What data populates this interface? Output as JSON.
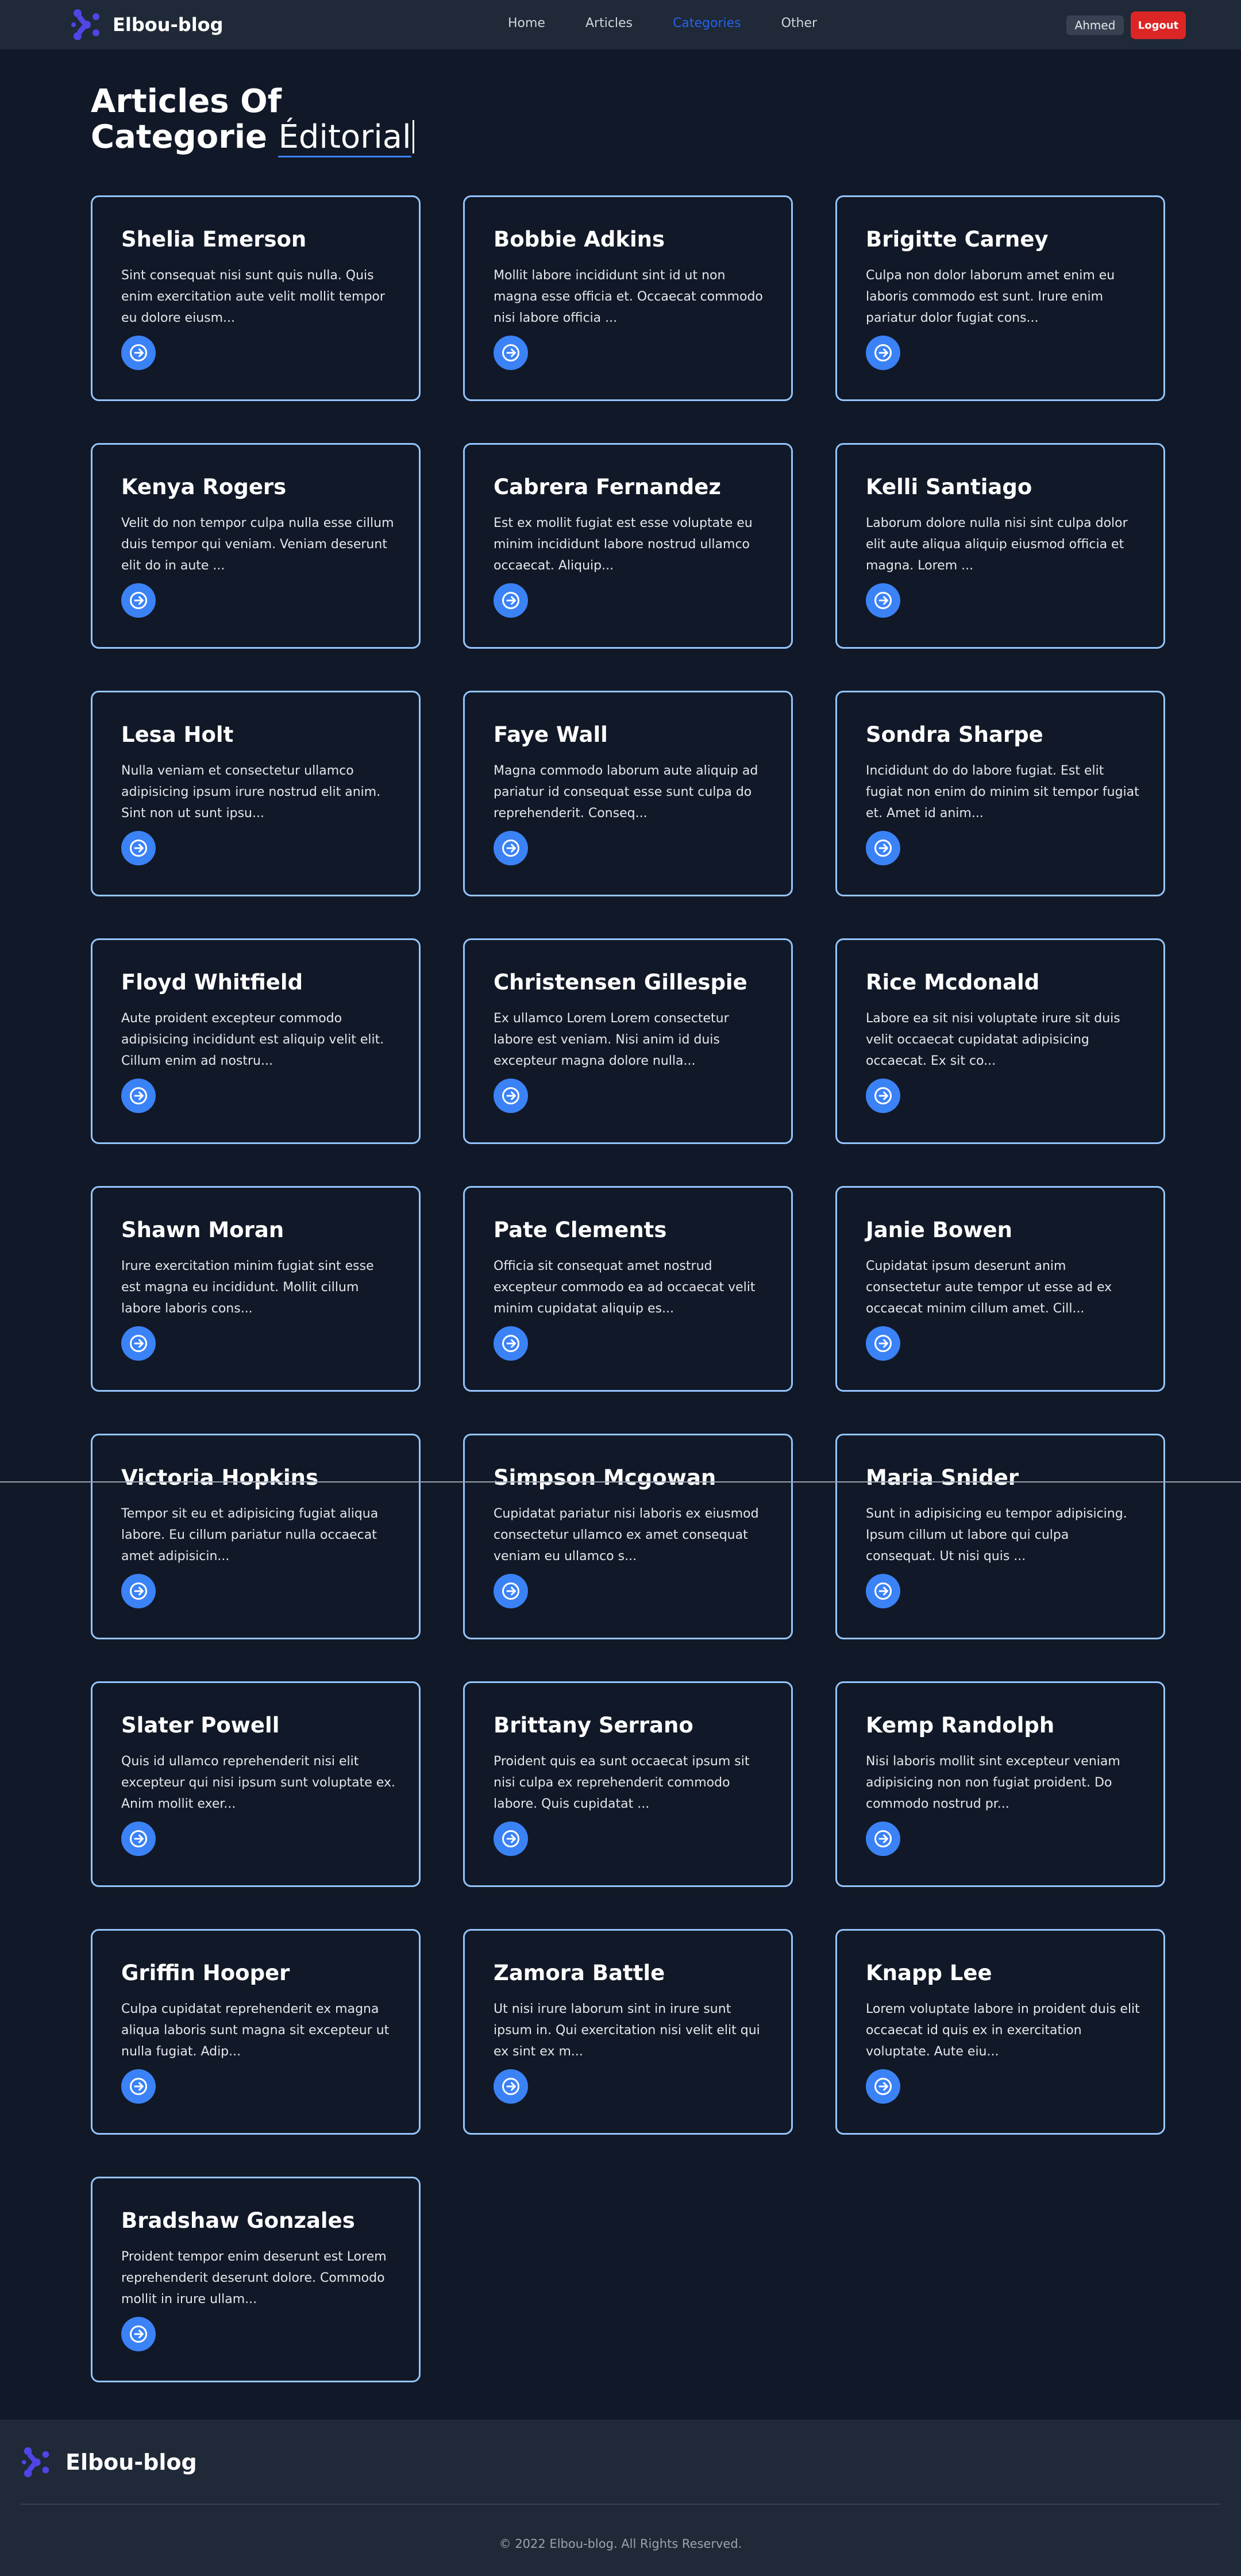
{
  "nav": {
    "brand": "Elbou-blog",
    "links": [
      {
        "label": "Home"
      },
      {
        "label": "Articles"
      },
      {
        "label": "Categories"
      },
      {
        "label": "Other"
      }
    ],
    "user": "Ahmed",
    "logout": "Logout"
  },
  "page": {
    "title_line1": "Articles Of",
    "title_line2_prefix": "Categorie ",
    "title_category": "Éditorial"
  },
  "articles": [
    {
      "name": "Shelia Emerson",
      "excerpt": "Sint consequat nisi sunt quis nulla. Quis enim exercitation aute velit mollit tempor eu dolore eiusm..."
    },
    {
      "name": "Bobbie Adkins",
      "excerpt": "Mollit labore incididunt sint id ut non magna esse officia et. Occaecat commodo nisi labore officia ..."
    },
    {
      "name": "Brigitte Carney",
      "excerpt": "Culpa non dolor laborum amet enim eu laboris commodo est sunt. Irure enim pariatur dolor fugiat cons..."
    },
    {
      "name": "Kenya Rogers",
      "excerpt": "Velit do non tempor culpa nulla esse cillum duis tempor qui veniam. Veniam deserunt elit do in aute ..."
    },
    {
      "name": "Cabrera Fernandez",
      "excerpt": "Est ex mollit fugiat est esse voluptate eu minim incididunt labore nostrud ullamco occaecat. Aliquip..."
    },
    {
      "name": "Kelli Santiago",
      "excerpt": "Laborum dolore nulla nisi sint culpa dolor elit aute aliqua aliquip eiusmod officia et magna. Lorem ..."
    },
    {
      "name": "Lesa Holt",
      "excerpt": "Nulla veniam et consectetur ullamco adipisicing ipsum irure nostrud elit anim. Sint non ut sunt ipsu..."
    },
    {
      "name": "Faye Wall",
      "excerpt": "Magna commodo laborum aute aliquip ad pariatur id consequat esse sunt culpa do reprehenderit. Conseq..."
    },
    {
      "name": "Sondra Sharpe",
      "excerpt": "Incididunt do do labore fugiat. Est elit fugiat non enim do minim sit tempor fugiat et. Amet id anim..."
    },
    {
      "name": "Floyd Whitfield",
      "excerpt": "Aute proident excepteur commodo adipisicing incididunt est aliquip velit elit. Cillum enim ad nostru..."
    },
    {
      "name": "Christensen Gillespie",
      "excerpt": "Ex ullamco Lorem Lorem consectetur labore est veniam. Nisi anim id duis excepteur magna dolore nulla..."
    },
    {
      "name": "Rice Mcdonald",
      "excerpt": "Labore ea sit nisi voluptate irure sit duis velit occaecat cupidatat adipisicing occaecat. Ex sit co..."
    },
    {
      "name": "Shawn Moran",
      "excerpt": "Irure exercitation minim fugiat sint esse est magna eu incididunt. Mollit cillum labore laboris cons..."
    },
    {
      "name": "Pate Clements",
      "excerpt": "Officia sit consequat amet nostrud excepteur commodo ea ad occaecat velit minim cupidatat aliquip es..."
    },
    {
      "name": "Janie Bowen",
      "excerpt": "Cupidatat ipsum deserunt anim consectetur aute tempor ut esse ad ex occaecat minim cillum amet. Cill..."
    },
    {
      "name": "Victoria Hopkins",
      "excerpt": "Tempor sit eu et adipisicing fugiat aliqua labore. Eu cillum pariatur nulla occaecat amet adipisicin..."
    },
    {
      "name": "Simpson Mcgowan",
      "excerpt": "Cupidatat pariatur nisi laboris ex eiusmod consectetur ullamco ex amet consequat veniam eu ullamco s..."
    },
    {
      "name": "Maria Snider",
      "excerpt": "Sunt in adipisicing eu tempor adipisicing. Ipsum cillum ut labore qui culpa consequat. Ut nisi quis ..."
    },
    {
      "name": "Slater Powell",
      "excerpt": "Quis id ullamco reprehenderit nisi elit excepteur qui nisi ipsum sunt voluptate ex. Anim mollit exer..."
    },
    {
      "name": "Brittany Serrano",
      "excerpt": "Proident quis ea sunt occaecat ipsum sit nisi culpa ex reprehenderit commodo labore. Quis cupidatat ..."
    },
    {
      "name": "Kemp Randolph",
      "excerpt": "Nisi laboris mollit sint excepteur veniam adipisicing non non fugiat proident. Do commodo nostrud pr..."
    },
    {
      "name": "Griffin Hooper",
      "excerpt": "Culpa cupidatat reprehenderit ex magna aliqua laboris sunt magna sit excepteur ut nulla fugiat. Adip..."
    },
    {
      "name": "Zamora Battle",
      "excerpt": "Ut nisi irure laborum sint in irure sunt ipsum in. Qui exercitation nisi velit elit qui ex sint ex m..."
    },
    {
      "name": "Knapp Lee",
      "excerpt": "Lorem voluptate labore in proident duis elit occaecat id quis ex in exercitation voluptate. Aute eiu..."
    },
    {
      "name": "Bradshaw Gonzales",
      "excerpt": "Proident tempor enim deserunt est Lorem reprehenderit deserunt dolore. Commodo mollit in irure ullam..."
    }
  ],
  "card_icon": "arrow-circle-right-icon",
  "footer": {
    "brand": "Elbou-blog",
    "copyright": "© 2022 Elbou-blog. All Rights Reserved."
  },
  "colors": {
    "background": "#111827",
    "navbar": "#1f2937",
    "card_border": "#93c5fd",
    "accent": "#3b82f6",
    "active_link": "#2563eb",
    "logout": "#dc2626",
    "logo": "#4f46e5"
  }
}
